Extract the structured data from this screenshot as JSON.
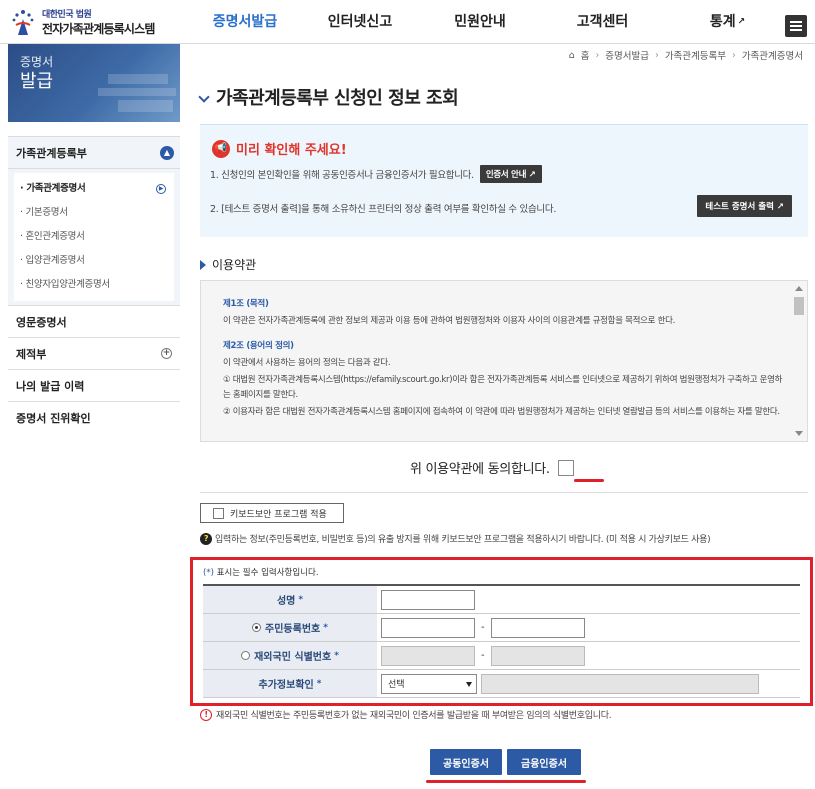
{
  "header": {
    "logo_sub": "대한민국 법원",
    "logo_main": "전자가족관계등록시스템",
    "nav": [
      {
        "label": "증명서발급",
        "active": true
      },
      {
        "label": "인터넷신고",
        "active": false
      },
      {
        "label": "민원안내",
        "active": false
      },
      {
        "label": "고객센터",
        "active": false
      },
      {
        "label": "통계",
        "active": false
      }
    ],
    "nav_ext_icon": "external-link-icon",
    "menu_icon": "hamburger-icon"
  },
  "sidebar": {
    "banner_line1": "증명서",
    "banner_line2": "발급",
    "items": [
      {
        "label": "가족관계등록부"
      },
      {
        "label": "영문증명서"
      },
      {
        "label": "제적부"
      },
      {
        "label": "나의 발급 이력"
      },
      {
        "label": "증명서 진위확인"
      }
    ],
    "sub_items": [
      {
        "label": "· 가족관계증명서"
      },
      {
        "label": "· 기본증명서"
      },
      {
        "label": "· 혼인관계증명서"
      },
      {
        "label": "· 입양관계증명서"
      },
      {
        "label": "· 친양자입양관계증명서"
      }
    ]
  },
  "breadcrumb": [
    "홈",
    "증명서발급",
    "가족관계등록부",
    "가족관계증명서"
  ],
  "page_title": "가족관계등록부 신청인 정보 조회",
  "notice": {
    "title": "미리 확인해 주세요!",
    "line1": "1. 신청인의 본인확인을 위해 공동인증서나 금융인증서가 필요합니다.",
    "line1_btn": "인증서 안내",
    "line2": "2. [테스트 증명서 출력]을 통해 소유하신 프린터의 정상 출력 여부를 확인하실 수 있습니다.",
    "line2_btn": "테스트 증명서 출력"
  },
  "terms": {
    "heading": "이용약관",
    "art1_title": "제1조 (목적)",
    "art1_body": "이 약관은 전자가족관계등록에 관한 정보의 제공과 이용 등에 관하여 법원행정처와 이용자 사이의 이용관계를 규정함을 목적으로 한다.",
    "art2_title": "제2조 (용어의 정의)",
    "art2_intro": "이 약관에서 사용하는 용어의 정의는 다음과 같다.",
    "art2_item1": "① 대법원 전자가족관계등록시스템(https://efamily.scourt.go.kr)이라 함은 전자가족관계등록 서비스를 인터넷으로 제공하기 위하여 법원행정처가 구축하고 운영하는 홈페이지를 말한다.",
    "art2_item2": "② 이용자라 함은 대법원 전자가족관계등록시스템 홈페이지에 접속하여 이 약관에 따라 법원행정처가 제공하는 인터넷 열람발급 등의 서비스를 이용하는 자를 말한다.",
    "agree_label": "위 이용약관에 동의합니다."
  },
  "keyboard": {
    "label": "키보드보안 프로그램 적용",
    "info": "입력하는 정보(주민등록번호, 비밀번호 등)의 유출 방지를 위해 키보드보안 프로그램을 적용하시기 바랍니다. (미 적용 시 가상키보드 사용)"
  },
  "form": {
    "req_note_star": "(*)",
    "req_note": " 표시는 필수 입력사항입니다.",
    "name_label": "성명",
    "rrn_label": "주민등록번호",
    "foreign_label": "재외국민 식별번호",
    "extra_label": "추가정보확인",
    "required_mark": "*",
    "dash": "-",
    "select_value": "선택"
  },
  "warning": "재외국민 식별번호는 주민등록번호가 없는 재외국민이 인증서를 발급받을 때 부여받은 임의의 식별번호입니다.",
  "buttons": {
    "joint_cert": "공동인증서",
    "finance_cert": "금융인증서"
  },
  "colors": {
    "accent": "#2a6fc9",
    "highlight_red": "#e0202a",
    "button_blue": "#2d5aa4"
  }
}
